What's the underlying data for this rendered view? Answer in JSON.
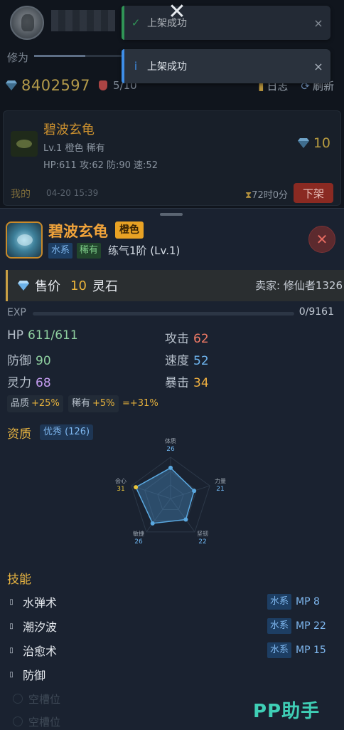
{
  "header": {
    "level_label": "修为",
    "level_progress": 0.55,
    "spirit_stones": "8402597",
    "slots": "5/10",
    "log_label": "日志",
    "refresh_label": "刷新"
  },
  "listing": {
    "name": "碧波玄龟",
    "subtitle": "Lv.1 橙色 稀有",
    "stats": "HP:611 攻:62 防:90 速:52",
    "price": "10",
    "owner": "我的",
    "time": "04-20 15:39",
    "remaining": "72时0分",
    "unlist_label": "下架"
  },
  "toasts": [
    {
      "icon": "check-icon",
      "text": "上架成功",
      "color": "#3bbf6a"
    },
    {
      "icon": "info-icon",
      "text": "上架成功",
      "color": "#3e8ee8"
    }
  ],
  "detail": {
    "name": "碧波玄龟",
    "quality_tag": "橙色",
    "element_tag": "水系",
    "rarity_tag": "稀有",
    "stage": "练气1阶 (Lv.1)",
    "price_label": "售价",
    "price_value": "10",
    "price_unit": "灵石",
    "seller": "卖家: 修仙者1326",
    "exp_label": "EXP",
    "exp_value": "0/9161",
    "exp_progress": 0,
    "stats": {
      "hp_label": "HP",
      "hp_value": "611/611",
      "def_label": "防御",
      "def_value": "90",
      "spirit_label": "灵力",
      "spirit_value": "68",
      "atk_label": "攻击",
      "atk_value": "62",
      "spd_label": "速度",
      "spd_value": "52",
      "crit_label": "暴击",
      "crit_value": "34"
    },
    "bonuses": {
      "quality_label": "品质",
      "quality_value": "+25%",
      "rarity_label": "稀有",
      "rarity_value": "+5%",
      "total": "=+31%"
    },
    "aptitude_title": "资质",
    "aptitude_tag": "优秀 (126)",
    "radar": [
      {
        "label": "体质",
        "value": "26"
      },
      {
        "label": "力量",
        "value": "21"
      },
      {
        "label": "坚韧",
        "value": "22"
      },
      {
        "label": "敏捷",
        "value": "26"
      },
      {
        "label": "会心",
        "value": "31"
      }
    ],
    "skills_title": "技能",
    "skills": [
      {
        "name": "水弹术",
        "element": "水系",
        "mp": "MP 8"
      },
      {
        "name": "潮汐波",
        "element": "水系",
        "mp": "MP 22"
      },
      {
        "name": "治愈术",
        "element": "水系",
        "mp": "MP 15"
      },
      {
        "name": "防御",
        "element": "",
        "mp": ""
      }
    ],
    "empty_slots": [
      "空槽位",
      "空槽位"
    ]
  },
  "watermark": "PP助手",
  "colors": {
    "accent_gold": "#e8b33c",
    "water_blue": "#7fb8f0",
    "orange_tag": "#e8a224",
    "danger_red": "#8a2a22"
  }
}
